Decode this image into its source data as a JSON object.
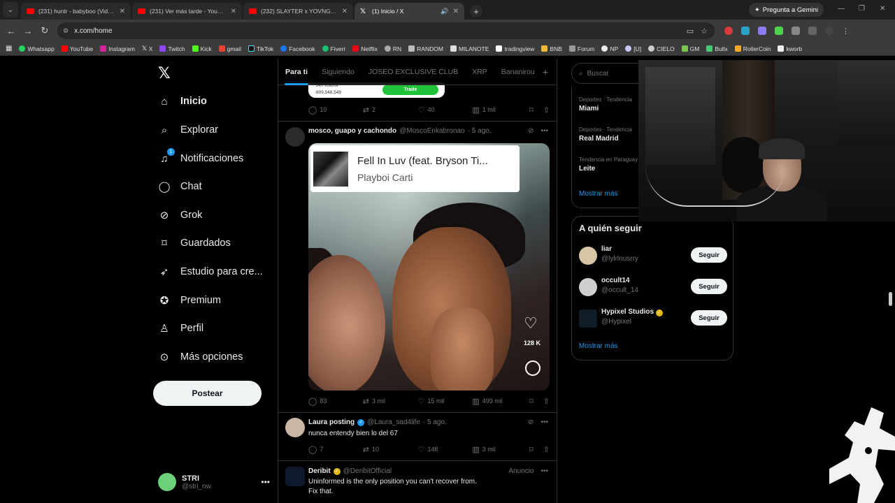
{
  "browser": {
    "tabs": [
      {
        "title": "(231) huntr - babyboo (Video O",
        "icon": "youtube-icon"
      },
      {
        "title": "(231) Ver más tarde - YouTube",
        "icon": "youtube-icon"
      },
      {
        "title": "(232) SLAYTER x YOVNGCHIMI",
        "icon": "youtube-icon"
      },
      {
        "title": "(1) Inicio / X",
        "icon": "x-icon",
        "active": true
      }
    ],
    "gemini_label": "Pregunta a Gemini",
    "url": "x.com/home",
    "bookmarks": [
      "Whatsapp",
      "YouTube",
      "Instagram",
      "X",
      "Twitch",
      "Kick",
      "gmail",
      "TikTok",
      "Facebook",
      "Fiverr",
      "Netflix",
      "RN",
      "RANDOM",
      "MILANOTE",
      "tradingview",
      "BNB",
      "Forum",
      "NP",
      "[U]",
      "CIELO",
      "GM",
      "Bullx",
      "RollerCoin",
      "kworb"
    ]
  },
  "sidebar": {
    "logo": "𝕏",
    "items": [
      {
        "label": "Inicio",
        "icon": "home-icon"
      },
      {
        "label": "Explorar",
        "icon": "search-icon"
      },
      {
        "label": "Notificaciones",
        "icon": "bell-icon",
        "badge": "1"
      },
      {
        "label": "Chat",
        "icon": "chat-icon"
      },
      {
        "label": "Grok",
        "icon": "grok-icon"
      },
      {
        "label": "Guardados",
        "icon": "bookmark-icon"
      },
      {
        "label": "Estudio para cre...",
        "icon": "rocket-icon"
      },
      {
        "label": "Premium",
        "icon": "premium-icon"
      },
      {
        "label": "Perfil",
        "icon": "profile-icon"
      },
      {
        "label": "Más opciones",
        "icon": "more-icon"
      }
    ],
    "post_button": "Postear",
    "account": {
      "name": "STRI",
      "handle": "@stri_nw"
    }
  },
  "feed": {
    "tabs": [
      "Para ti",
      "Siguiendo",
      "JOSEO EXCLUSIVE CLUB",
      "XRP",
      "Bananirou"
    ],
    "prev_post": {
      "card_line1": "24h Volume",
      "card_line2": "809,548,549",
      "trade_label": "Trade",
      "replies": "10",
      "reposts": "2",
      "likes": "40",
      "views": "1 mil"
    },
    "post1": {
      "name": "mosco, guapo y cachondo",
      "handle": "@MoscoEnkabronao",
      "time": "· 5 ago.",
      "song_title": "Fell In Luv (feat. Bryson Ti...",
      "song_artist": "Playboi Carti",
      "overlay_likes": "128 K",
      "replies": "83",
      "reposts": "3 mil",
      "likes": "15 mil",
      "views": "499 mil"
    },
    "post2": {
      "name": "Laura posting",
      "handle": "@Laura_sad4life",
      "time": "· 5 ago.",
      "text": "nunca entendy bien lo del 67",
      "replies": "7",
      "reposts": "10",
      "likes": "148",
      "views": "3 mil"
    },
    "post3": {
      "name": "Deribit",
      "handle": "@DeribitOfficial",
      "ad": "Anuncio",
      "text_line1": "Uninformed is the only position you can't recover from.",
      "text_line2": "Fix that."
    }
  },
  "right": {
    "search_placeholder": "Buscar",
    "trends": [
      {
        "category": "Deportes · Tendencia",
        "name": "Miami"
      },
      {
        "category": "Deportes · Tendencia",
        "name": "Real Madrid"
      },
      {
        "category": "Tendencia en Paraguay",
        "name": "Leite"
      }
    ],
    "trends_more": "Mostrar más",
    "follow_title": "A quién seguir",
    "follow": [
      {
        "name": "liar",
        "handle": "@lylrlnusrry",
        "button": "Seguir"
      },
      {
        "name": "occult14",
        "handle": "@occult_14",
        "button": "Seguir"
      },
      {
        "name": "Hypixel Studios",
        "handle": "@Hypixel",
        "button": "Seguir"
      }
    ],
    "follow_more": "Mostrar más"
  },
  "colors": {
    "accent": "#1d9bf0",
    "background": "#000000",
    "muted": "#71767b",
    "trade": "#21c33b"
  }
}
